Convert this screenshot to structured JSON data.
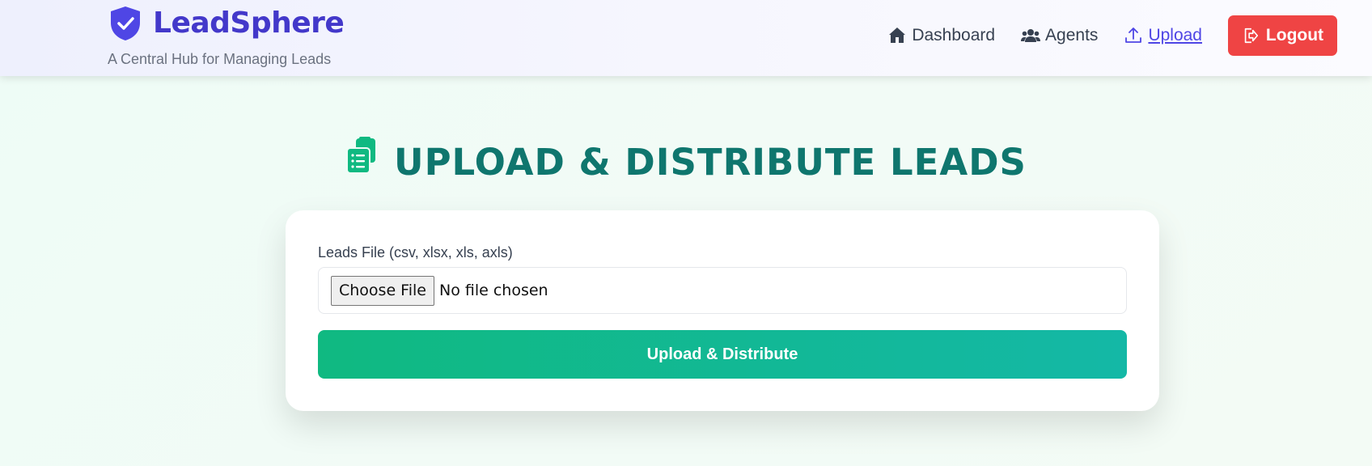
{
  "brand": {
    "name": "LeadSphere",
    "tagline": "A Central Hub for Managing Leads",
    "logo_icon": "shield-check-icon",
    "color": "#4338ca"
  },
  "nav": {
    "items": [
      {
        "label": "Dashboard",
        "icon": "home-icon",
        "active": false
      },
      {
        "label": "Agents",
        "icon": "users-icon",
        "active": false
      },
      {
        "label": "Upload",
        "icon": "upload-icon",
        "active": true
      }
    ],
    "logout": {
      "label": "Logout",
      "icon": "logout-icon",
      "color": "#ef4444"
    }
  },
  "page": {
    "title": "UPLOAD & DISTRIBUTE LEADS",
    "title_icon": "clipboard-list-icon",
    "title_color": "#0f766e"
  },
  "form": {
    "file_label": "Leads File (csv, xlsx, xls, axls)",
    "choose_button": "Choose File",
    "file_status": "No file chosen",
    "submit_label": "Upload & Distribute",
    "accent": "#10b981"
  }
}
